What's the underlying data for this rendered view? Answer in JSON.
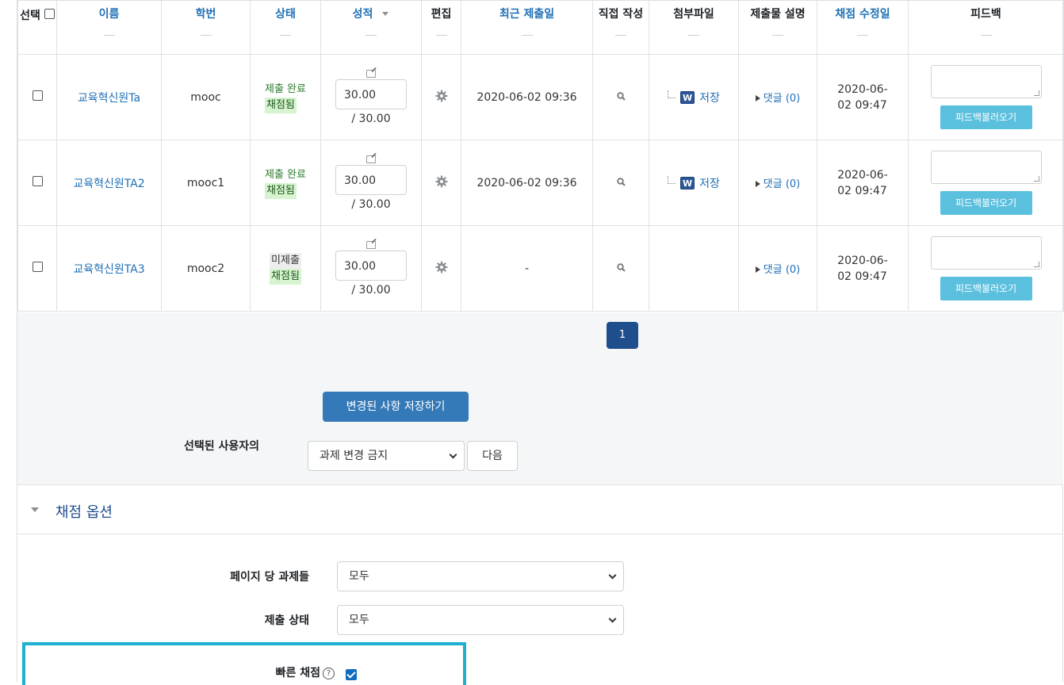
{
  "table": {
    "headers": {
      "select": "선택",
      "name": "이름",
      "student_id": "학번",
      "status": "상태",
      "grade": "성적",
      "edit": "편집",
      "last_submitted": "최근 제출일",
      "online_text": "직접 작성",
      "file": "첨부파일",
      "submission_comment": "제출물 설명",
      "grade_modified": "채점 수정일",
      "feedback": "피드백"
    },
    "rows": [
      {
        "name": "교육혁신원Ta",
        "student_id": "mooc",
        "status": "제출 완료",
        "graded": "채점됨",
        "grade": "30.00",
        "max": "/ 30.00",
        "submitted": "2020-06-02 09:36",
        "file": "저장",
        "comments": "댓글 (0)",
        "modified_line1": "2020-06-",
        "modified_line2": "02 09:47",
        "feedback_btn": "피드백불러오기"
      },
      {
        "name": "교육혁신원TA2",
        "student_id": "mooc1",
        "status": "제출 완료",
        "graded": "채점됨",
        "grade": "30.00",
        "max": "/ 30.00",
        "submitted": "2020-06-02 09:36",
        "file": "저장",
        "comments": "댓글 (0)",
        "modified_line1": "2020-06-",
        "modified_line2": "02 09:47",
        "feedback_btn": "피드백불러오기"
      },
      {
        "name": "교육혁신원TA3",
        "student_id": "mooc2",
        "status": "미제출",
        "graded": "채점됨",
        "grade": "30.00",
        "max": "/ 30.00",
        "submitted": "-",
        "file": "",
        "comments": "댓글 (0)",
        "modified_line1": "2020-06-",
        "modified_line2": "02 09:47",
        "feedback_btn": "피드백불러오기"
      }
    ]
  },
  "pagination": {
    "current_page": "1"
  },
  "actions": {
    "save_label": "변경된 사항 저장하기",
    "with_selected_label": "선택된 사용자의",
    "with_selected_value": "과제 변경 금지",
    "next_label": "다음"
  },
  "options": {
    "section_title": "채점 옵션",
    "per_page_label": "페이지 당 과제들",
    "per_page_value": "모두",
    "filter_label": "제출 상태",
    "filter_value": "모두",
    "quick_grading_label": "빠른 채점",
    "quick_grading_help": "?",
    "quick_grading_checked": true
  },
  "icons": {
    "word_file": "word-file-icon",
    "gear": "gear-icon",
    "search": "search-icon",
    "edit": "edit-icon"
  },
  "colors": {
    "link": "#1f6fb5",
    "primary_button": "#3479b8",
    "page_active": "#1f4e8c",
    "info_button": "#5bc0de",
    "highlight_border": "#1fb0cf",
    "graded_bg": "#d7f3d0"
  }
}
